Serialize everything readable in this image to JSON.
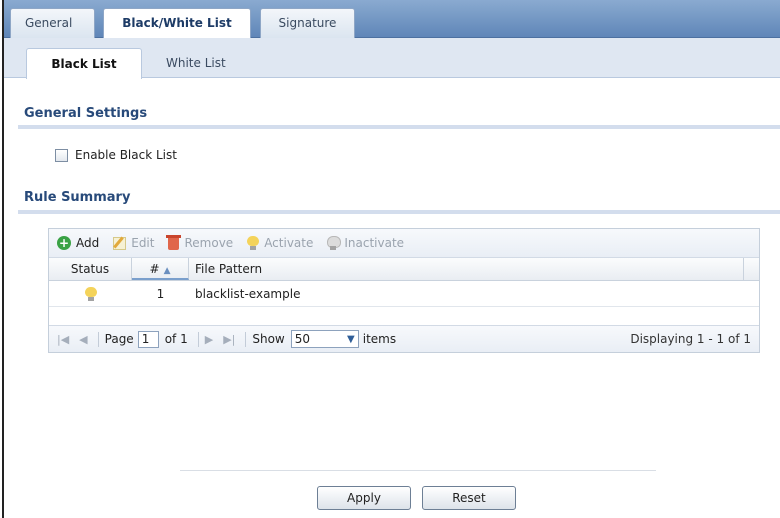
{
  "top_tabs": [
    {
      "label": "General",
      "active": false
    },
    {
      "label": "Black/White List",
      "active": true
    },
    {
      "label": "Signature",
      "active": false
    }
  ],
  "sub_tabs": [
    {
      "label": "Black List",
      "active": true
    },
    {
      "label": "White List",
      "active": false
    }
  ],
  "general_settings": {
    "title": "General Settings",
    "enable_checkbox_label": "Enable Black List",
    "enable_checked": false
  },
  "rule_summary": {
    "title": "Rule Summary",
    "toolbar": {
      "add": "Add",
      "edit": "Edit",
      "remove": "Remove",
      "activate": "Activate",
      "inactivate": "Inactivate"
    },
    "columns": {
      "status": "Status",
      "number": "#",
      "pattern": "File Pattern"
    },
    "rows": [
      {
        "status_icon": "lightbulb-on-icon",
        "number": "1",
        "pattern": "blacklist-example"
      }
    ],
    "pager": {
      "page_label": "Page",
      "page_value": "1",
      "of_label": "of 1",
      "show_label": "Show",
      "show_value": "50",
      "items_label": "items",
      "display_text": "Displaying 1 - 1 of 1"
    }
  },
  "buttons": {
    "apply": "Apply",
    "reset": "Reset"
  },
  "colors": {
    "tab_bar": "#6f92c2",
    "section_title": "#284a7a",
    "add_icon": "#3aa245"
  }
}
